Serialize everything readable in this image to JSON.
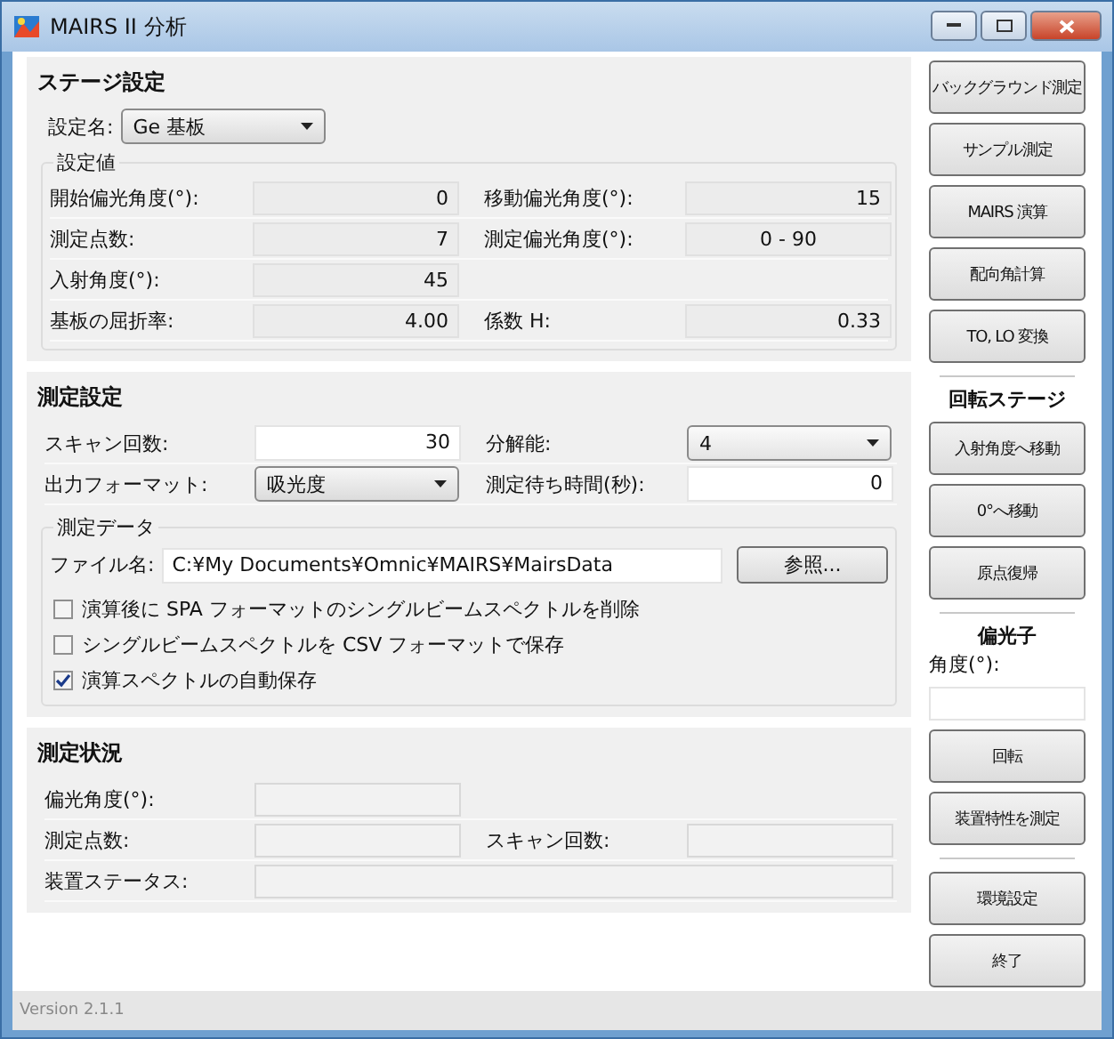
{
  "window": {
    "title": "MAIRS II 分析"
  },
  "stage_settings": {
    "title": "ステージ設定",
    "setting_name": {
      "label": "設定名:",
      "value": "Ge 基板"
    },
    "group_title": "設定値",
    "rows": [
      [
        {
          "label": "開始偏光角度(°):",
          "value": "0",
          "kind": "number"
        },
        {
          "label": "移動偏光角度(°):",
          "value": "15",
          "kind": "number"
        }
      ],
      [
        {
          "label": "測定点数:",
          "value": "7",
          "kind": "number"
        },
        {
          "label": "測定偏光角度(°):",
          "value": "0 - 90",
          "kind": "range"
        }
      ],
      [
        {
          "label": "入射角度(°):",
          "value": "45",
          "kind": "number"
        }
      ],
      [
        {
          "label": "基板の屈折率:",
          "value": "4.00",
          "kind": "number"
        },
        {
          "label": "係数 H:",
          "value": "0.33",
          "kind": "number"
        }
      ]
    ]
  },
  "measurement_settings": {
    "title": "測定設定",
    "rows": [
      [
        {
          "label": "スキャン回数:",
          "value": "30",
          "kind": "input"
        },
        {
          "label": "分解能:",
          "value": "4",
          "kind": "dropdown"
        }
      ],
      [
        {
          "label": "出力フォーマット:",
          "value": "吸光度",
          "kind": "dropdown"
        },
        {
          "label": "測定待ち時間(秒):",
          "value": "0",
          "kind": "input"
        }
      ]
    ],
    "data_group": {
      "title": "測定データ",
      "file_label": "ファイル名:",
      "file_value": "C:¥My Documents¥Omnic¥MAIRS¥MairsData",
      "browse_button": "参照...",
      "checkboxes": [
        {
          "label": "演算後に SPA フォーマットのシングルビームスペクトルを削除",
          "checked": false
        },
        {
          "label": "シングルビームスペクトルを CSV フォーマットで保存",
          "checked": false
        },
        {
          "label": "演算スペクトルの自動保存",
          "checked": true
        }
      ]
    }
  },
  "status": {
    "title": "測定状況",
    "rows": [
      [
        {
          "label": "偏光角度(°):",
          "wide": false
        }
      ],
      [
        {
          "label": "測定点数:",
          "wide": false
        },
        {
          "label": "スキャン回数:",
          "wide": false
        }
      ],
      [
        {
          "label": "装置ステータス:",
          "wide": true
        }
      ]
    ]
  },
  "sidebar": [
    {
      "kind": "button",
      "label": "バックグラウンド測定"
    },
    {
      "kind": "button",
      "label": "サンプル測定"
    },
    {
      "kind": "button",
      "label": "MAIRS 演算"
    },
    {
      "kind": "button",
      "label": "配向角計算"
    },
    {
      "kind": "button",
      "label": "TO, LO 変換"
    },
    {
      "kind": "divider"
    },
    {
      "kind": "heading",
      "label": "回転ステージ"
    },
    {
      "kind": "button",
      "label": "入射角度へ移動"
    },
    {
      "kind": "button",
      "label": "0°へ移動"
    },
    {
      "kind": "button",
      "label": "原点復帰"
    },
    {
      "kind": "divider"
    },
    {
      "kind": "heading",
      "label": "偏光子"
    },
    {
      "kind": "label",
      "label": "角度(°):"
    },
    {
      "kind": "field"
    },
    {
      "kind": "button",
      "label": "回転"
    },
    {
      "kind": "button",
      "label": "装置特性を測定"
    },
    {
      "kind": "divider"
    },
    {
      "kind": "button",
      "label": "環境設定"
    },
    {
      "kind": "button",
      "label": "終了"
    }
  ],
  "status_bar": {
    "version": "Version 2.1.1"
  }
}
